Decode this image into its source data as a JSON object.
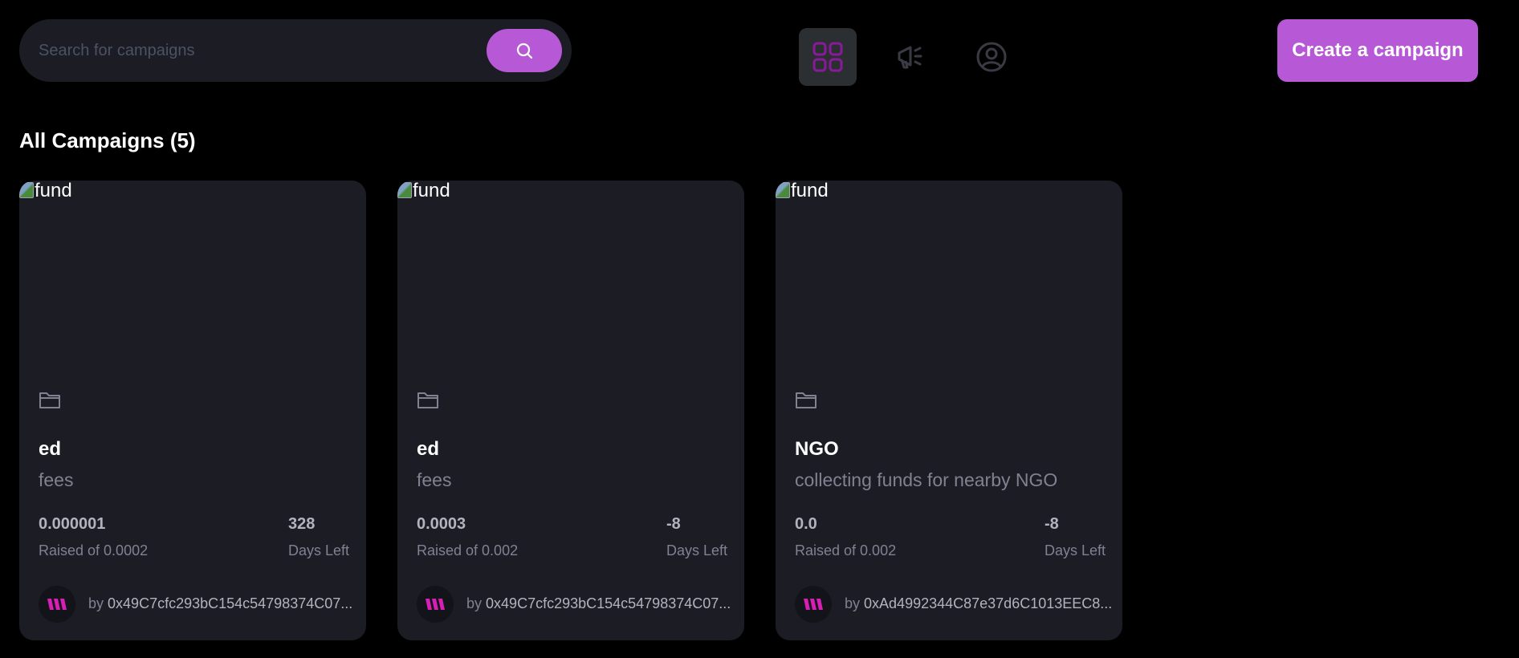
{
  "search": {
    "placeholder": "Search for campaigns"
  },
  "nav": {
    "icons": [
      "dashboard-icon",
      "campaign-icon",
      "profile-icon"
    ]
  },
  "header": {
    "create_label": "Create a campaign"
  },
  "colors": {
    "accent": "#b759d6",
    "card_bg": "#1c1c24",
    "page_bg": "#000000",
    "nav_active": "#2c2f32"
  },
  "section": {
    "title": "All Campaigns (5)"
  },
  "campaigns": [
    {
      "image_alt": "fund",
      "title": "ed",
      "description": "fees",
      "raised": "0.000001",
      "raised_label": "Raised of 0.0002",
      "days": "328",
      "days_label": "Days Left",
      "owner_prefix": "by",
      "owner": "0x49C7cfc293bC154c54798374C07..."
    },
    {
      "image_alt": "fund",
      "title": "ed",
      "description": "fees",
      "raised": "0.0003",
      "raised_label": "Raised of 0.002",
      "days": "-8",
      "days_label": "Days Left",
      "owner_prefix": "by",
      "owner": "0x49C7cfc293bC154c54798374C07..."
    },
    {
      "image_alt": "fund",
      "title": "NGO",
      "description": "collecting funds for nearby NGO",
      "raised": "0.0",
      "raised_label": "Raised of 0.002",
      "days": "-8",
      "days_label": "Days Left",
      "owner_prefix": "by",
      "owner": "0xAd4992344C87e37d6C1013EEC8..."
    }
  ]
}
